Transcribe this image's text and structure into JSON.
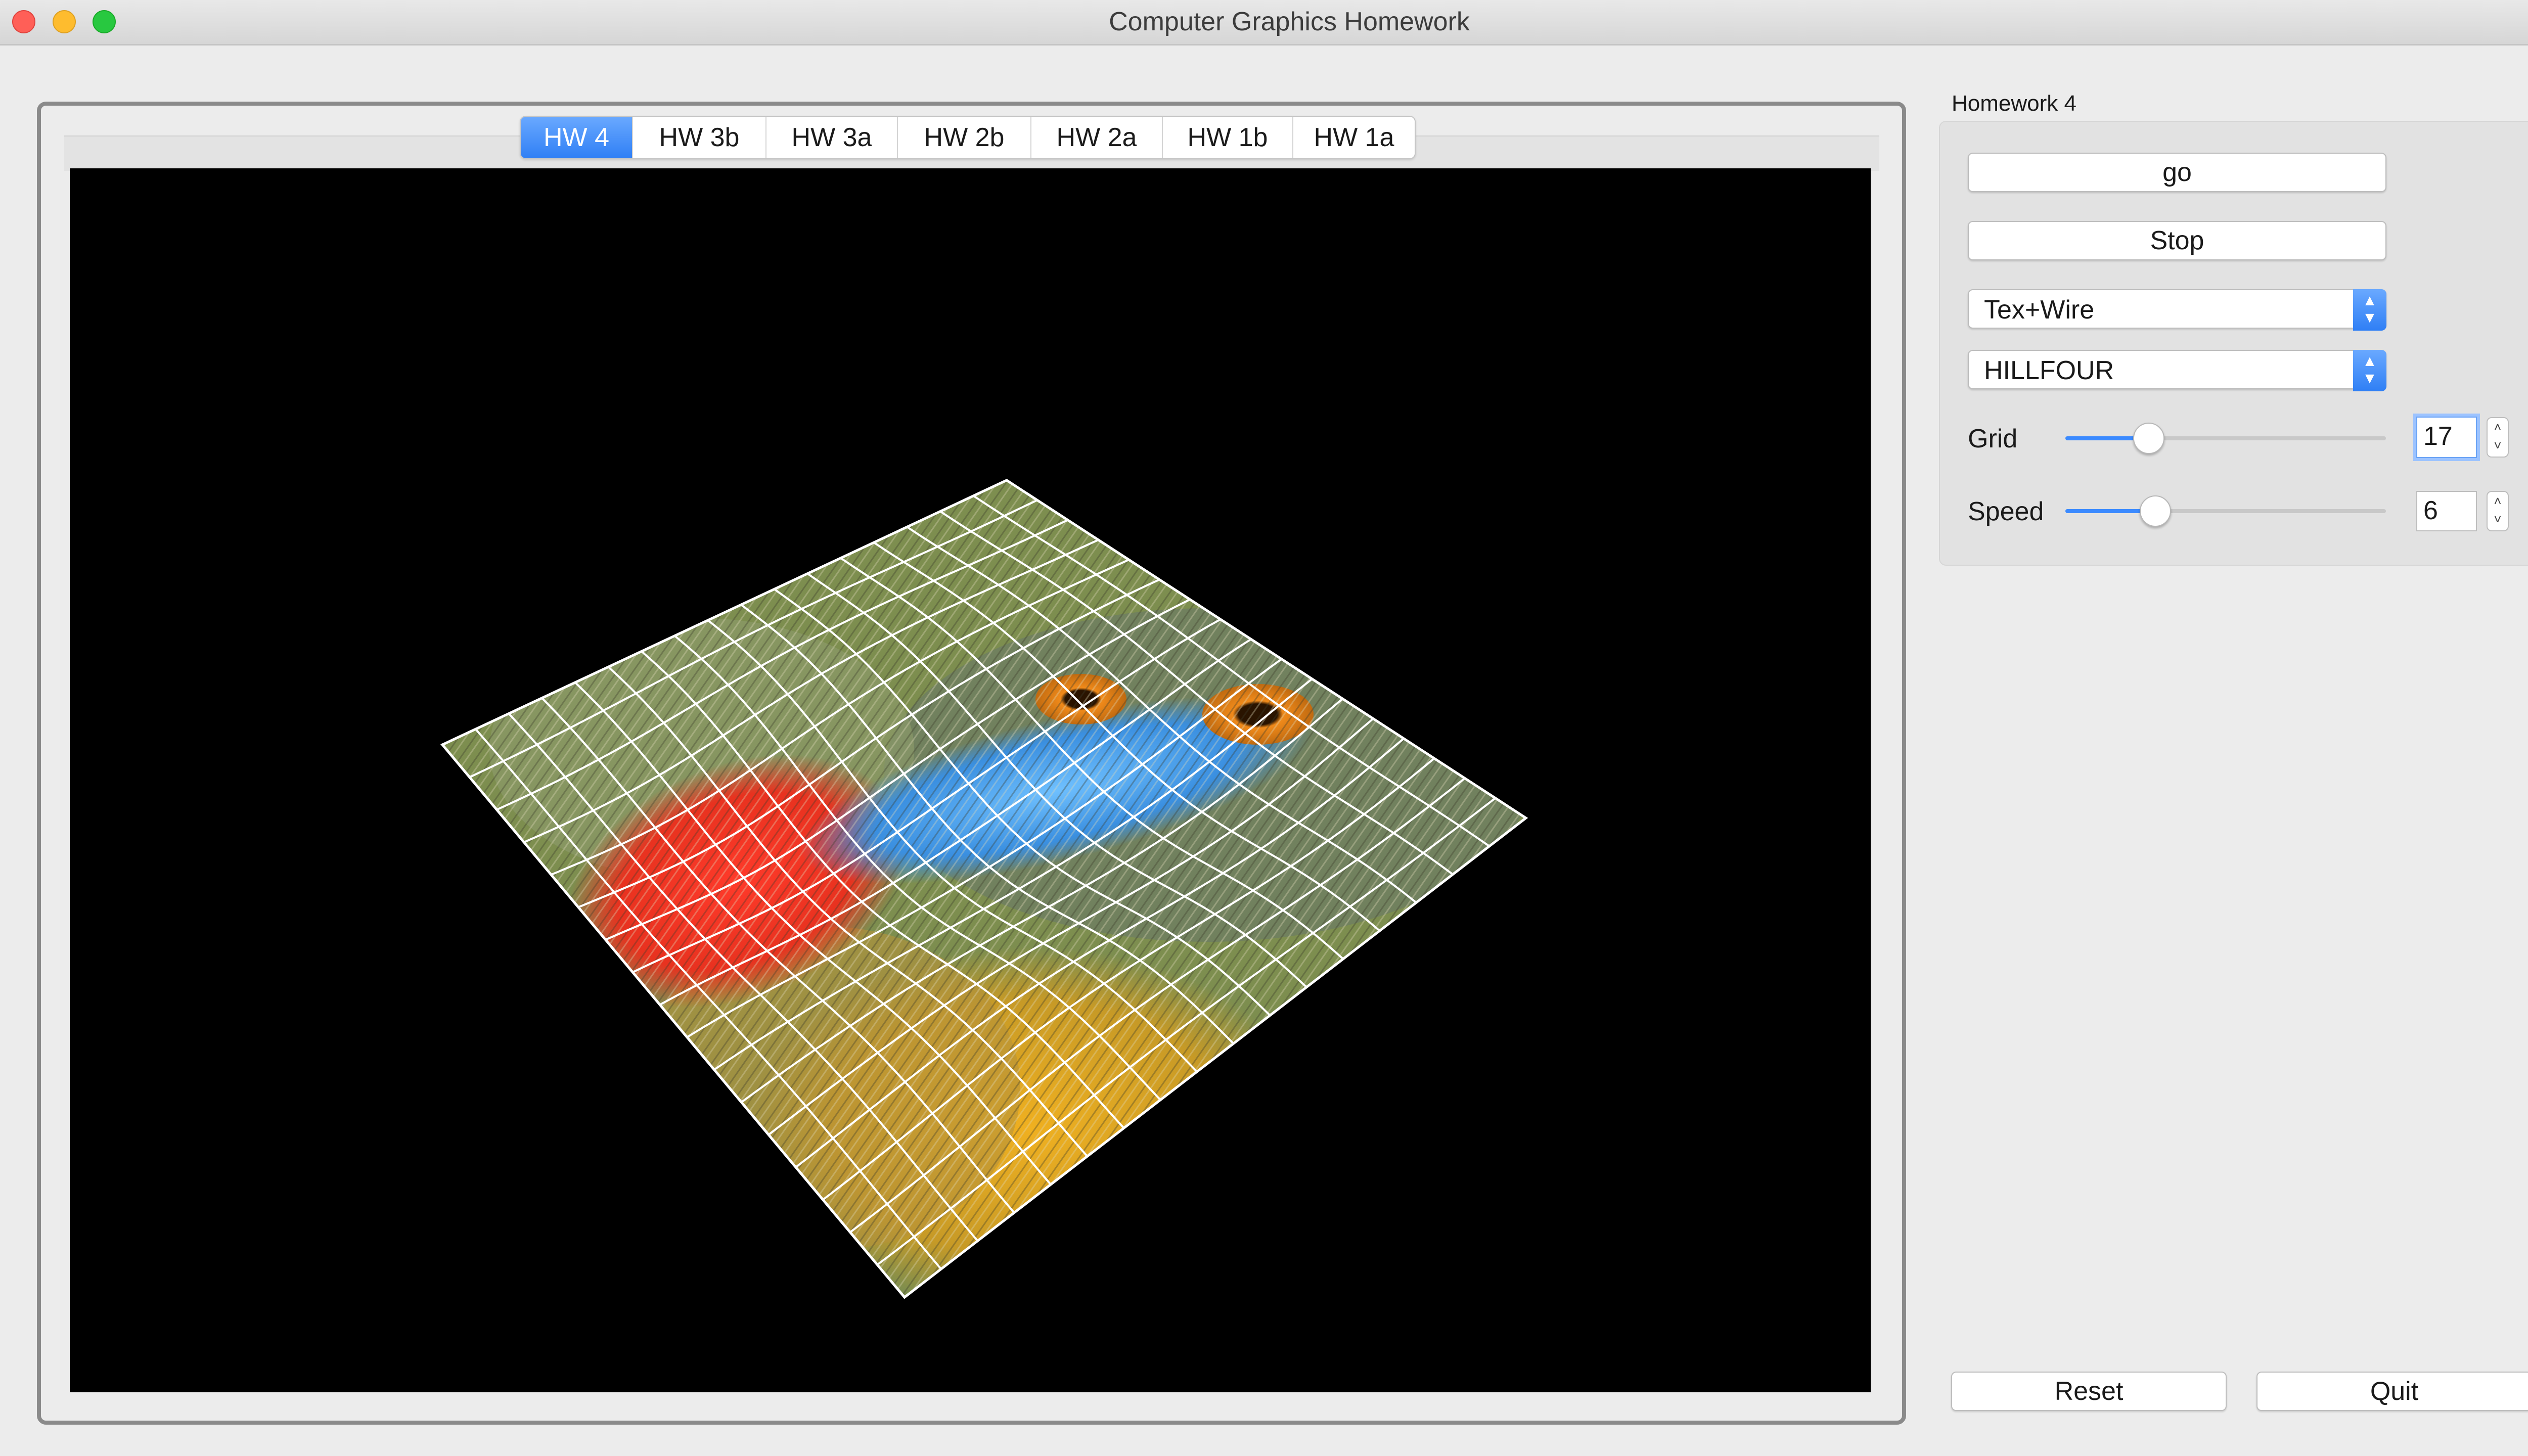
{
  "window": {
    "title": "Computer Graphics Homework"
  },
  "tabs": [
    {
      "label": "HW 4",
      "active": true
    },
    {
      "label": "HW 3b",
      "active": false
    },
    {
      "label": "HW 3a",
      "active": false
    },
    {
      "label": "HW 2b",
      "active": false
    },
    {
      "label": "HW 2a",
      "active": false
    },
    {
      "label": "HW 1b",
      "active": false
    },
    {
      "label": "HW 1a",
      "active": false
    }
  ],
  "panel": {
    "title": "Homework 4",
    "go_label": "go",
    "stop_label": "Stop",
    "render_mode": {
      "value": "Tex+Wire"
    },
    "surface": {
      "value": "HILLFOUR"
    },
    "grid": {
      "label": "Grid",
      "value": "17",
      "slider_fraction": 0.26
    },
    "speed": {
      "label": "Speed",
      "value": "6",
      "slider_fraction": 0.28
    }
  },
  "footer": {
    "reset_label": "Reset",
    "quit_label": "Quit"
  },
  "colors": {
    "accent": "#3b8aff",
    "viewport_bg": "#000000",
    "wire": "#ffffff"
  },
  "icons": {
    "dropdown": "chevron-updown-icon",
    "stepper": "stepper-arrows-icon"
  }
}
